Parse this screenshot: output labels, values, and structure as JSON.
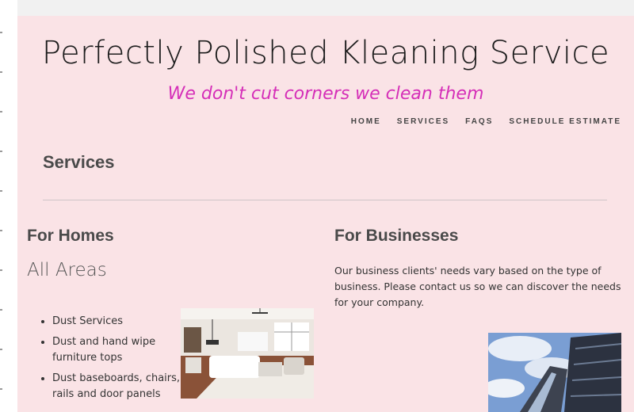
{
  "site": {
    "title": "Perfectly Polished Kleaning Service",
    "tagline": "We don't cut corners we clean them"
  },
  "nav": {
    "items": [
      {
        "label": "HOME"
      },
      {
        "label": "SERVICES"
      },
      {
        "label": "FAQS"
      },
      {
        "label": "SCHEDULE ESTIMATE"
      }
    ]
  },
  "main": {
    "heading": "Services",
    "homes": {
      "title": "For Homes",
      "subtitle": "All Areas",
      "services": [
        "Dust Services",
        "Dust and hand wipe furniture tops",
        "Dust baseboards, chairs, rails and door panels"
      ]
    },
    "businesses": {
      "title": "For Businesses",
      "text": "Our business clients' needs vary based on the type of business. Please contact us so we can discover the needs for your company."
    }
  },
  "colors": {
    "page_background": "#fae3e6",
    "tagline": "#d52fb8",
    "heading": "#4a4a4a"
  }
}
